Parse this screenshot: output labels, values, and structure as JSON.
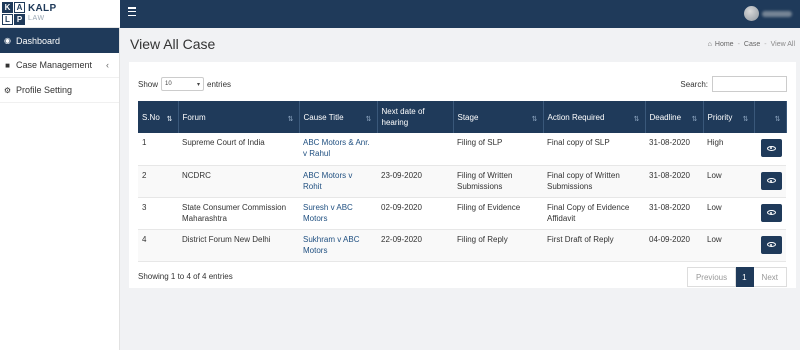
{
  "brand": {
    "logo_letters": [
      "K",
      "A",
      "L",
      "P"
    ],
    "name": "KALP",
    "sub": "LAW"
  },
  "colors": {
    "primary": "#1f3a5a",
    "link": "#1f4f80"
  },
  "topbar": {
    "menu_icon": "hamburger-icon"
  },
  "sidebar": {
    "items": [
      {
        "label": "Dashboard",
        "icon": "dashboard-icon",
        "glyph": "◉",
        "active": true
      },
      {
        "label": "Case Management",
        "icon": "briefcase-icon",
        "glyph": "■",
        "arrow": "‹"
      },
      {
        "label": "Profile Setting",
        "icon": "gears-icon",
        "glyph": "⚙"
      }
    ]
  },
  "page": {
    "title": "View All Case"
  },
  "breadcrumb": {
    "home": "Home",
    "section": "Case",
    "current": "View All",
    "sep": "-"
  },
  "table_controls": {
    "show_label": "Show",
    "entries_value": "10",
    "entries_label": "entries",
    "search_label": "Search:"
  },
  "table": {
    "columns": [
      "S.No",
      "Forum",
      "Cause Title",
      "Next date of hearing",
      "Stage",
      "Action Required",
      "Deadline",
      "Priority",
      ""
    ],
    "rows": [
      {
        "sno": "1",
        "forum": "Supreme Court of India",
        "cause": "ABC Motors & Anr. v Rahul",
        "next": "",
        "stage": "Filing of SLP",
        "action": "Final copy of SLP",
        "deadline": "31-08-2020",
        "priority": "High"
      },
      {
        "sno": "2",
        "forum": "NCDRC",
        "cause": "ABC Motors v Rohit",
        "next": "23-09-2020",
        "stage": "Filing of Written Submissions",
        "action": "Final copy of Written Submissions",
        "deadline": "31-08-2020",
        "priority": "Low"
      },
      {
        "sno": "3",
        "forum": "State Consumer Commission Maharashtra",
        "cause": "Suresh v ABC Motors",
        "next": "02-09-2020",
        "stage": "Filing of Evidence",
        "action": "Final Copy of Evidence Affidavit",
        "deadline": "31-08-2020",
        "priority": "Low"
      },
      {
        "sno": "4",
        "forum": "District Forum New Delhi",
        "cause": "Sukhram v ABC Motors",
        "next": "22-09-2020",
        "stage": "Filing of Reply",
        "action": "First Draft of Reply",
        "deadline": "04-09-2020",
        "priority": "Low"
      }
    ]
  },
  "footer": {
    "info": "Showing 1 to 4 of 4 entries",
    "prev": "Previous",
    "page": "1",
    "next": "Next"
  }
}
